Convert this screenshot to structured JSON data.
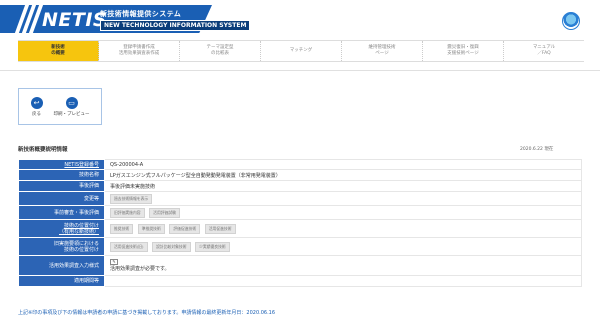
{
  "header": {
    "logo": "NETIS",
    "title_jp": "新技術情報提供システム",
    "title_en": "NEW TECHNOLOGY INFORMATION SYSTEM",
    "accent": "#1a5fb4"
  },
  "nav": [
    {
      "line1": "新技術",
      "line2": "の概要",
      "active": true
    },
    {
      "line1": "登録申請書作成",
      "line2": "活用効果調査表作成",
      "active": false
    },
    {
      "line1": "テーマ設定型",
      "line2": "の比較表",
      "active": false
    },
    {
      "line1": "マッチング",
      "line2": "",
      "active": false
    },
    {
      "line1": "維持管理技術",
      "line2": "ページ",
      "active": false
    },
    {
      "line1": "震災復旧・復興",
      "line2": "支援技術ページ",
      "active": false
    },
    {
      "line1": "マニュアル",
      "line2": "／FAQ",
      "active": false
    }
  ],
  "tools": {
    "back": "戻る",
    "print": "印刷・プレビュー"
  },
  "section": {
    "title": "新技術概要説明情報",
    "date": "2020.6.22 現在"
  },
  "rows": {
    "reg_no_label": "NETIS登録番号",
    "reg_no": "QS-200004-A",
    "tech_name_label": "技術名称",
    "tech_name": "LPガスエンジン式フルパッケージ型全自動発動発電装置（非常用発電装置）",
    "eval_label": "事後評価",
    "eval": "事後評価未実施技術",
    "change_label": "変更等",
    "change_tag": "過去技術情報を表示",
    "pre_eval_label": "事前審査・事後評価",
    "pre_eval_tags": [
      "旧評価実施内容",
      "活用評価試験"
    ],
    "position_label_1": "技術の位置付け",
    "position_label_2": "（有用な新技術）",
    "position_tags": [
      "推奨技術",
      "準推奨技術",
      "評価促進技術",
      "活用促進技術"
    ],
    "ret_label_1": "旧実施要領における",
    "ret_label_2": "技術の位置付け",
    "ret_tags": [
      "活用促進技術(旧)",
      "設計比較対象技術",
      "少実績優良技術"
    ],
    "input_label": "活用効果調査入力様式",
    "input_icon": "edit",
    "input_note": "活用効果調査が必要です。",
    "period_label": "適用期間等",
    "period": ""
  },
  "footnote": "上記※印の事項及び下の情報は申請者の申請に基づき掲載しております。申請情報の最終更新年月日：2020.06.16"
}
